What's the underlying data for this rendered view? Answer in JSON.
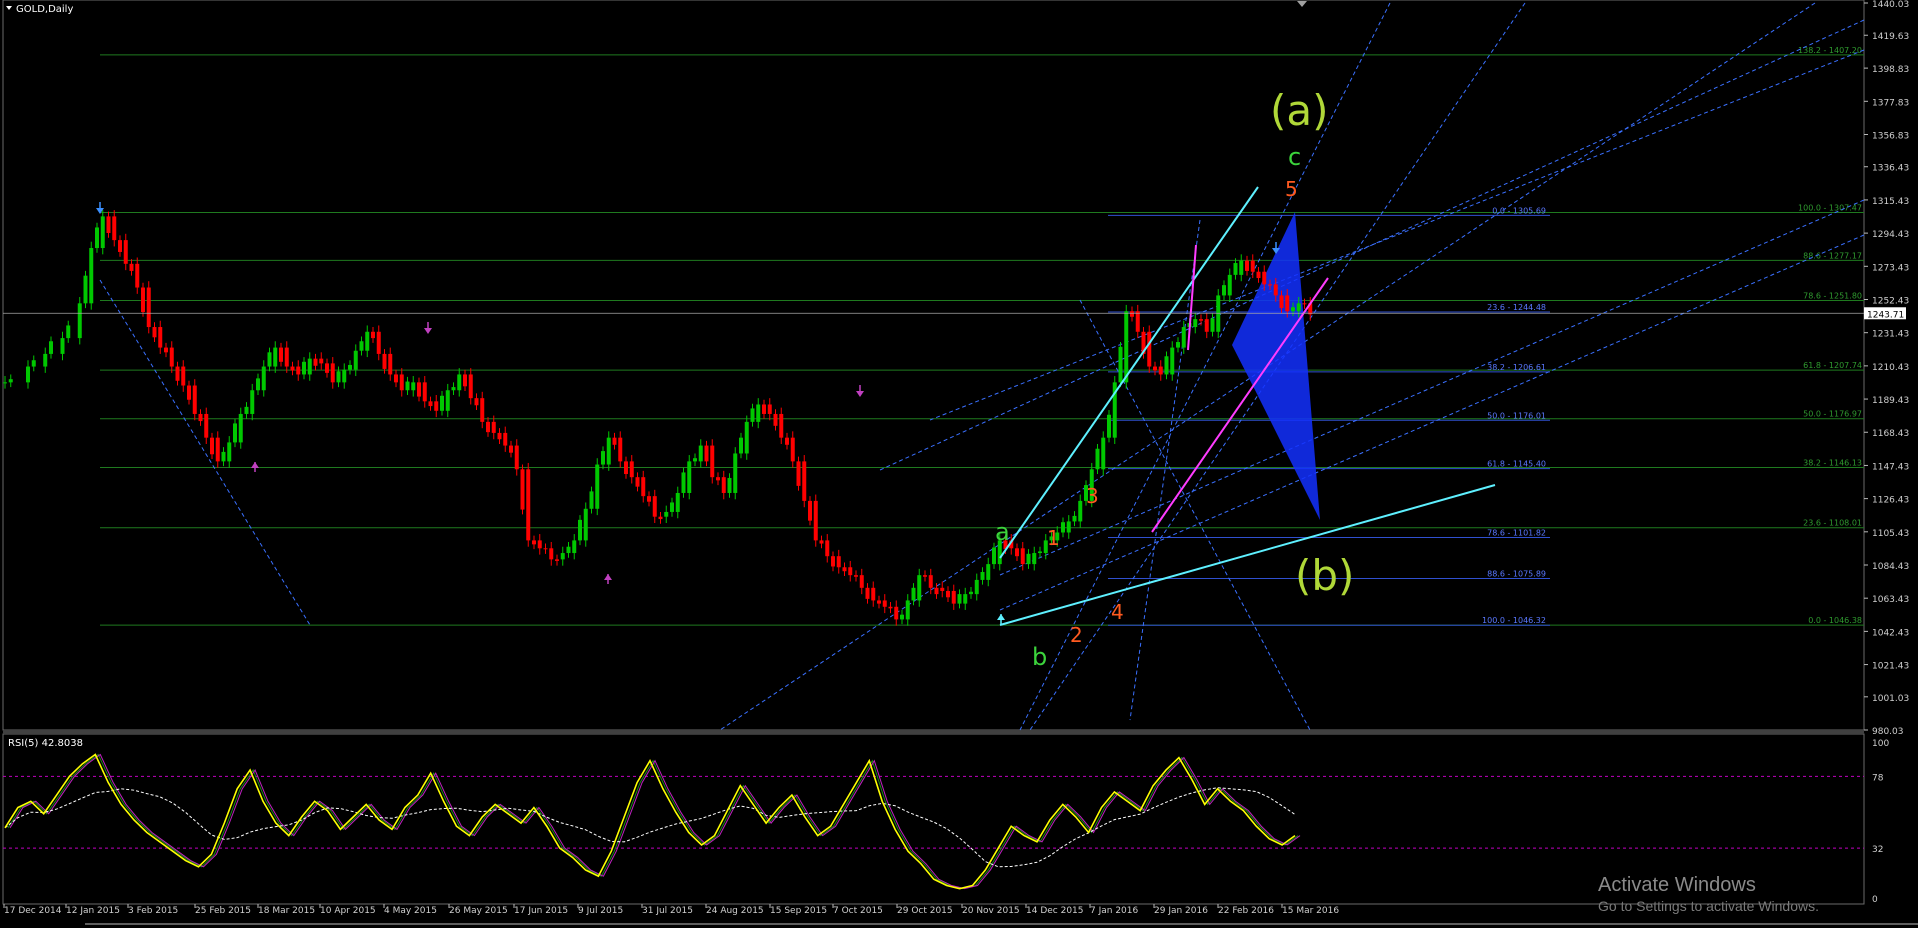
{
  "window": {
    "title": "GOLD,Daily"
  },
  "chart_data": [
    {
      "type": "candlestick",
      "symbol": "GOLD",
      "timeframe": "Daily",
      "ylim": [
        980.03,
        1440.0
      ],
      "y_ticks": [
        "1440.03",
        "1419.63",
        "1398.83",
        "1377.83",
        "1356.83",
        "1336.43",
        "1315.43",
        "1294.43",
        "1273.43",
        "1252.43",
        "1231.43",
        "1210.43",
        "1189.43",
        "1168.43",
        "1147.43",
        "1126.43",
        "1105.43",
        "1084.43",
        "1063.43",
        "1042.43",
        "1021.43",
        "1001.03",
        "980.03"
      ],
      "current_price": "1243.71",
      "x_ticks": [
        "17 Dec 2014",
        "12 Jan 2015",
        "3 Feb 2015",
        "25 Feb 2015",
        "18 Mar 2015",
        "10 Apr 2015",
        "4 May 2015",
        "26 May 2015",
        "17 Jun 2015",
        "9 Jul 2015",
        "31 Jul 2015",
        "24 Aug 2015",
        "15 Sep 2015",
        "7 Oct 2015",
        "29 Oct 2015",
        "20 Nov 2015",
        "14 Dec 2015",
        "7 Jan 2016",
        "29 Jan 2016",
        "22 Feb 2016",
        "15 Mar 2016"
      ],
      "price_path": [
        [
          0,
          1200
        ],
        [
          8,
          1210
        ],
        [
          14,
          1218
        ],
        [
          20,
          1228
        ],
        [
          26,
          1250
        ],
        [
          30,
          1285
        ],
        [
          34,
          1305
        ],
        [
          38,
          1290
        ],
        [
          42,
          1275
        ],
        [
          46,
          1260
        ],
        [
          50,
          1235
        ],
        [
          54,
          1222
        ],
        [
          58,
          1210
        ],
        [
          62,
          1198
        ],
        [
          66,
          1180
        ],
        [
          70,
          1165
        ],
        [
          74,
          1150
        ],
        [
          78,
          1162
        ],
        [
          82,
          1180
        ],
        [
          86,
          1195
        ],
        [
          90,
          1210
        ],
        [
          94,
          1222
        ],
        [
          98,
          1210
        ],
        [
          102,
          1205
        ],
        [
          106,
          1215
        ],
        [
          110,
          1212
        ],
        [
          114,
          1200
        ],
        [
          118,
          1208
        ],
        [
          122,
          1220
        ],
        [
          126,
          1232
        ],
        [
          130,
          1218
        ],
        [
          134,
          1205
        ],
        [
          138,
          1195
        ],
        [
          142,
          1200
        ],
        [
          146,
          1188
        ],
        [
          150,
          1182
        ],
        [
          154,
          1195
        ],
        [
          158,
          1205
        ],
        [
          162,
          1190
        ],
        [
          166,
          1175
        ],
        [
          170,
          1168
        ],
        [
          174,
          1160
        ],
        [
          178,
          1145
        ],
        [
          182,
          1100
        ],
        [
          186,
          1095
        ],
        [
          190,
          1088
        ],
        [
          194,
          1092
        ],
        [
          198,
          1100
        ],
        [
          202,
          1120
        ],
        [
          206,
          1148
        ],
        [
          210,
          1165
        ],
        [
          214,
          1150
        ],
        [
          218,
          1140
        ],
        [
          222,
          1128
        ],
        [
          226,
          1115
        ],
        [
          230,
          1118
        ],
        [
          234,
          1130
        ],
        [
          238,
          1150
        ],
        [
          242,
          1160
        ],
        [
          246,
          1140
        ],
        [
          250,
          1130
        ],
        [
          254,
          1155
        ],
        [
          258,
          1175
        ],
        [
          262,
          1186
        ],
        [
          266,
          1180
        ],
        [
          270,
          1165
        ],
        [
          274,
          1150
        ],
        [
          278,
          1125
        ],
        [
          282,
          1100
        ],
        [
          286,
          1090
        ],
        [
          290,
          1083
        ],
        [
          294,
          1078
        ],
        [
          298,
          1070
        ],
        [
          302,
          1062
        ],
        [
          306,
          1058
        ],
        [
          310,
          1050
        ],
        [
          314,
          1062
        ],
        [
          318,
          1078
        ],
        [
          322,
          1070
        ],
        [
          326,
          1068
        ],
        [
          330,
          1060
        ],
        [
          334,
          1066
        ],
        [
          338,
          1075
        ],
        [
          342,
          1085
        ],
        [
          346,
          1100
        ],
        [
          350,
          1095
        ],
        [
          354,
          1085
        ],
        [
          358,
          1092
        ],
        [
          362,
          1100
        ],
        [
          366,
          1105
        ],
        [
          370,
          1112
        ],
        [
          374,
          1125
        ],
        [
          378,
          1145
        ],
        [
          382,
          1165
        ],
        [
          386,
          1200
        ],
        [
          390,
          1245
        ],
        [
          394,
          1232
        ],
        [
          398,
          1210
        ],
        [
          402,
          1205
        ],
        [
          406,
          1222
        ],
        [
          410,
          1235
        ],
        [
          414,
          1240
        ],
        [
          418,
          1232
        ],
        [
          422,
          1255
        ],
        [
          426,
          1268
        ],
        [
          430,
          1277
        ],
        [
          434,
          1270
        ],
        [
          438,
          1262
        ],
        [
          442,
          1255
        ],
        [
          446,
          1245
        ],
        [
          450,
          1250
        ],
        [
          454,
          1243
        ]
      ],
      "fib_levels_left": [
        "138.2 - 1407.20",
        "100.0 - 1307.47",
        "88.6 - 1277.17",
        "78.6 - 1251.80",
        "61.8 - 1207.74",
        "50.0 - 1176.97",
        "38.2 - 1146.13",
        "23.6 - 1108.01",
        "0.0 - 1046.38"
      ],
      "fib_levels_right": [
        "0.0 - 1305.69",
        "23.6 - 1244.48",
        "38.2 - 1206.61",
        "50.0 - 1176.01",
        "61.8 - 1145.40",
        "78.6 - 1101.82",
        "88.6 - 1075.89",
        "100.0 - 1046.32"
      ],
      "wave_labels": {
        "big_a": "(a)",
        "big_b": "(b)",
        "minor_a": "a",
        "minor_b": "b",
        "minor_c": "c",
        "w1": "1",
        "w2": "2",
        "w3": "3",
        "w4": "4",
        "w5": "5"
      },
      "colors": {
        "background": "#000000",
        "bull": "#00c800",
        "bear": "#ff0000",
        "fib_green": "#1f7a1f",
        "fib_blue": "#3050d0",
        "channel": "#3a70ff",
        "trend_cyan": "#5ef0ff",
        "trend_magenta": "#ff3cff",
        "pattern": "#1330ff",
        "wave_green": "#b0d838",
        "wave_orange": "#ff5a20",
        "wave_lime": "#3cd43c"
      }
    },
    {
      "type": "line",
      "name": "RSI(5) 42.8038",
      "ylim": [
        0,
        100
      ],
      "y_ticks": [
        "100",
        "78",
        "32",
        "0"
      ],
      "levels": [
        78,
        32
      ],
      "values": [
        45,
        58,
        62,
        54,
        66,
        78,
        86,
        92,
        74,
        60,
        50,
        42,
        36,
        30,
        24,
        20,
        28,
        48,
        70,
        82,
        62,
        48,
        40,
        52,
        62,
        56,
        44,
        52,
        60,
        50,
        44,
        58,
        66,
        80,
        62,
        46,
        40,
        52,
        60,
        54,
        48,
        58,
        46,
        32,
        26,
        18,
        14,
        30,
        52,
        74,
        88,
        70,
        55,
        42,
        34,
        40,
        56,
        72,
        60,
        48,
        58,
        66,
        52,
        40,
        46,
        60,
        74,
        88,
        62,
        44,
        30,
        22,
        12,
        8,
        6,
        8,
        18,
        32,
        46,
        40,
        36,
        50,
        60,
        52,
        42,
        58,
        68,
        62,
        56,
        72,
        82,
        90,
        76,
        60,
        70,
        62,
        56,
        46,
        38,
        34,
        40
      ],
      "colors": {
        "rsi": "#ffff00",
        "signal_green": "#1a8a1a",
        "signal_magenta": "#c020c0",
        "ma": "#ffffff",
        "level": "#c000c0"
      }
    }
  ],
  "watermark": {
    "line1": "Activate Windows",
    "line2": "Go to Settings to activate Windows."
  }
}
